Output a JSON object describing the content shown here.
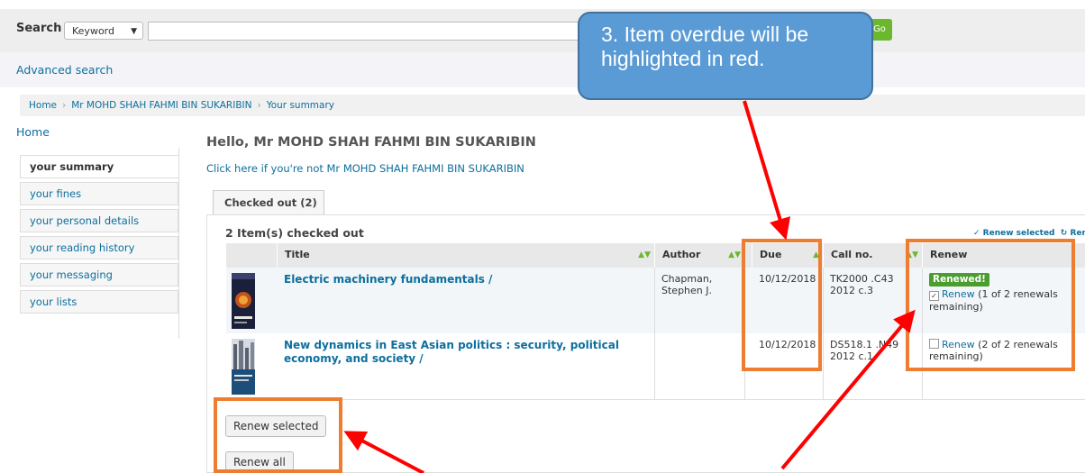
{
  "search": {
    "label": "Search",
    "type_selected": "Keyword",
    "input_value": "",
    "go_label": "Go",
    "advanced_label": "Advanced search"
  },
  "breadcrumb": [
    "Home",
    "Mr MOHD SHAH FAHMI BIN SUKARIBIN",
    "Your summary"
  ],
  "sidebar": {
    "home": "Home",
    "items": [
      {
        "label": "your summary",
        "active": true
      },
      {
        "label": "your fines"
      },
      {
        "label": "your personal details"
      },
      {
        "label": "your reading history"
      },
      {
        "label": "your messaging"
      },
      {
        "label": "your lists"
      }
    ]
  },
  "main": {
    "greeting": "Hello, Mr MOHD SHAH FAHMI BIN SUKARIBIN",
    "not_me": "Click here if you're not Mr MOHD SHAH FAHMI BIN SUKARIBIN",
    "tab_label": "Checked out (2)",
    "caption": "2 Item(s) checked out",
    "renew_selected_link": "✓ Renew selected",
    "renew_all_link": "↻ Renew all",
    "columns": [
      "Title",
      "Author",
      "Due",
      "Call no.",
      "Renew"
    ],
    "rows": [
      {
        "title": "Electric machinery fundamentals /",
        "author": "Chapman, Stephen J.",
        "due": "10/12/2018",
        "call_no": "TK2000 .C43 2012 c.3",
        "badge": "Renewed!",
        "checked": true,
        "renew_link": "Renew",
        "renew_note": "(1 of 2 renewals remaining)"
      },
      {
        "title": "New dynamics in East Asian politics : security, political economy, and society /",
        "author": "",
        "due": "10/12/2018",
        "call_no": "DS518.1 .N49 2012 c.1",
        "badge": "",
        "checked": false,
        "renew_link": "Renew",
        "renew_note": "(2 of 2 renewals remaining)"
      }
    ],
    "btn_renew_selected": "Renew selected",
    "btn_renew_all": "Renew all"
  },
  "annotation": {
    "callout_text": "3. Item overdue will be highlighted in red.",
    "box_color": "#ed7d31",
    "arrow_color": "#ff0000",
    "callout_color": "#5b9bd5"
  }
}
